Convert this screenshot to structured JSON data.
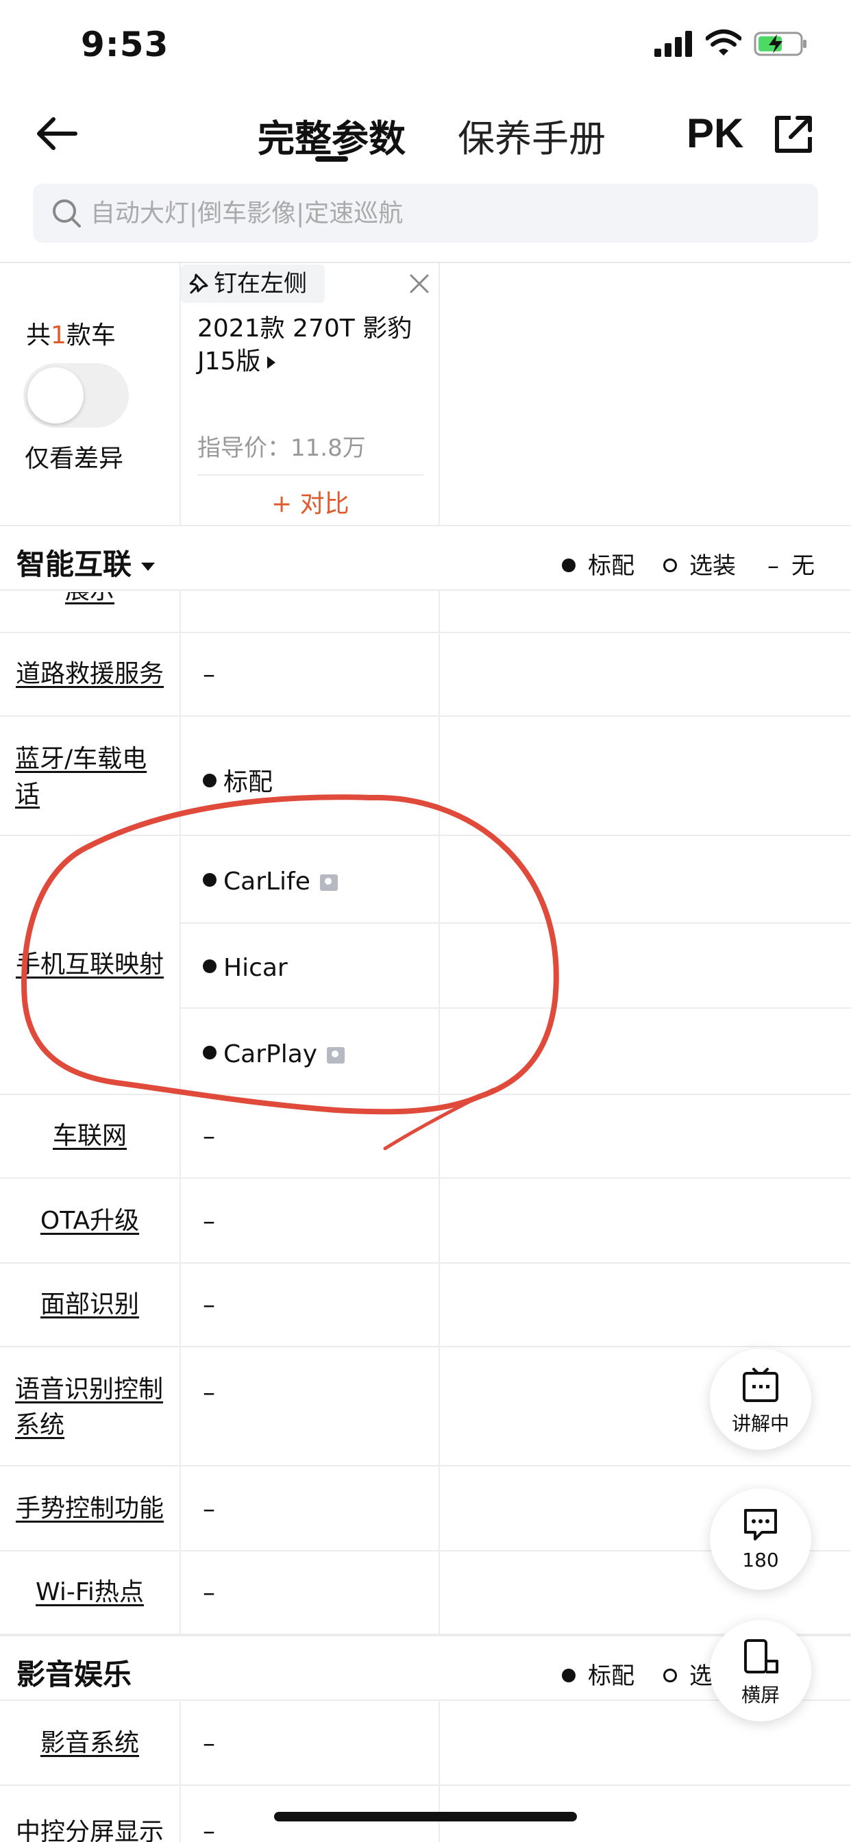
{
  "status_bar": {
    "time": "9:53"
  },
  "nav": {
    "tab_params": "完整参数",
    "tab_manual": "保养手册",
    "pk_label": "PK"
  },
  "search": {
    "placeholder": "自动大灯|倒车影像|定速巡航"
  },
  "header": {
    "count_prefix": "共",
    "count_num": "1",
    "count_suffix": "款车",
    "diff_label": "仅看差异",
    "pin_label": "钉在左侧",
    "car_name": "2021款 270T 影豹 J15版",
    "price": "指导价：11.8万",
    "compare": "+ 对比"
  },
  "sections": [
    {
      "title": "智能互联",
      "legend": {
        "std": "标配",
        "opt": "选装",
        "none_symbol": "–",
        "none": "无"
      }
    },
    {
      "title": "影音娱乐",
      "legend": {
        "std": "标配",
        "opt": "选装"
      }
    }
  ],
  "rows": [
    {
      "label": "展示",
      "value": ""
    },
    {
      "label": "道路救援服务",
      "value": "–"
    },
    {
      "label": "蓝牙/车载电话",
      "value": "标配"
    },
    {
      "label": "手机互联映射",
      "values": [
        "CarLife",
        "Hicar",
        "CarPlay"
      ]
    },
    {
      "label": "车联网",
      "value": "–"
    },
    {
      "label": "OTA升级",
      "value": "–"
    },
    {
      "label": "面部识别",
      "value": "–"
    },
    {
      "label": "语音识别控制系统",
      "value": "–"
    },
    {
      "label": "手势控制功能",
      "value": "–"
    },
    {
      "label": "Wi-Fi热点",
      "value": "–"
    },
    {
      "label": "影音系统",
      "value": "–"
    },
    {
      "label": "中控分屏显示",
      "value": "–"
    }
  ],
  "fabs": [
    {
      "label": "讲解中"
    },
    {
      "label": "180"
    },
    {
      "label": "横屏"
    }
  ],
  "colors": {
    "accent": "#e05a2b",
    "annotation": "#e04a3a"
  }
}
